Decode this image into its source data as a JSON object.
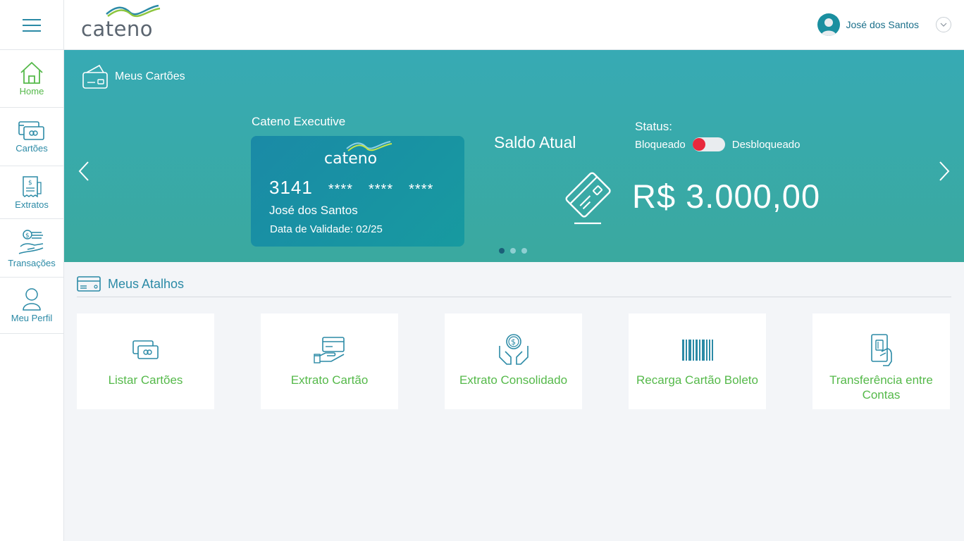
{
  "header": {
    "logo_text": "cateno",
    "user_name": "José dos Santos"
  },
  "sidebar": {
    "items": [
      {
        "label": "Home",
        "icon": "home-icon",
        "active": true
      },
      {
        "label": "Cartões",
        "icon": "cards-icon",
        "active": false
      },
      {
        "label": "Extratos",
        "icon": "statement-icon",
        "active": false
      },
      {
        "label": "Transações",
        "icon": "transactions-icon",
        "active": false
      },
      {
        "label": "Meu Perfil",
        "icon": "profile-icon",
        "active": false
      }
    ]
  },
  "banner": {
    "title": "Meus Cartões",
    "card_name": "Cateno Executive",
    "card_logo_text": "cateno",
    "card_number_first": "3141",
    "card_number_masked": [
      "****",
      "****",
      "****"
    ],
    "card_holder": "José dos Santos",
    "card_valid": "Data de Validade: 02/25",
    "saldo_label": "Saldo Atual",
    "saldo_value": "R$ 3.000,00",
    "status_label": "Status:",
    "status_off": "Bloqueado",
    "status_on": "Desbloqueado",
    "toggle_state": "blocked",
    "carousel_pages": 3,
    "carousel_active": 0
  },
  "shortcuts": {
    "title": "Meus Atalhos",
    "items": [
      {
        "label": "Listar Cartões",
        "icon": "list-cards-icon"
      },
      {
        "label": "Extrato Cartão",
        "icon": "card-hand-icon"
      },
      {
        "label": "Extrato Consolidado",
        "icon": "money-hands-icon"
      },
      {
        "label": "Recarga Cartão Boleto",
        "icon": "barcode-icon"
      },
      {
        "label": "Transferência entre Contas",
        "icon": "phone-card-icon"
      }
    ]
  },
  "colors": {
    "accent_teal": "#37aab4",
    "accent_green": "#55b94a",
    "text_blue": "#2b8aa6",
    "toggle_red": "#e8283c"
  }
}
